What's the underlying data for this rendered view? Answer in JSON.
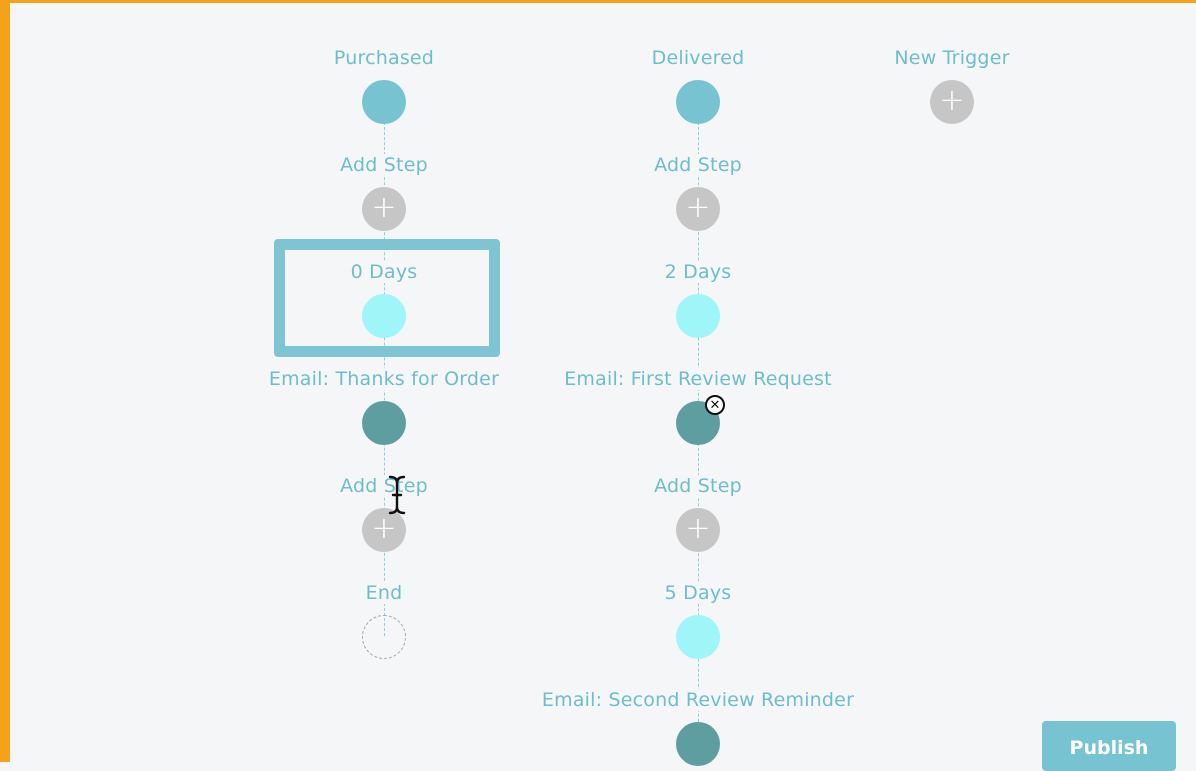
{
  "workflow": {
    "col1": {
      "trigger_label": "Purchased",
      "add_step_1_label": "Add Step",
      "delay_label": "0 Days",
      "email_label": "Email: Thanks for Order",
      "add_step_2_label": "Add Step",
      "end_label": "End"
    },
    "col2": {
      "trigger_label": "Delivered",
      "add_step_1_label": "Add Step",
      "delay_1_label": "2 Days",
      "email_1_label": "Email: First Review Request",
      "add_step_2_label": "Add Step",
      "delay_2_label": "5 Days",
      "email_2_label": "Email: Second Review Reminder"
    },
    "col3": {
      "trigger_label": "New Trigger"
    },
    "add_symbol": "+",
    "remove_symbol": "✕"
  },
  "publish_label": "Publish",
  "colors": {
    "accent_frame": "#f5a21b",
    "trigger": "#77c3d1",
    "delay": "#9ff5f8",
    "email": "#5e9ea1",
    "add": "#c6c6c6",
    "label_text": "#6fbccb"
  },
  "icons": {
    "add": "plus-icon",
    "remove": "close-icon",
    "cursor": "text-cursor-icon"
  }
}
